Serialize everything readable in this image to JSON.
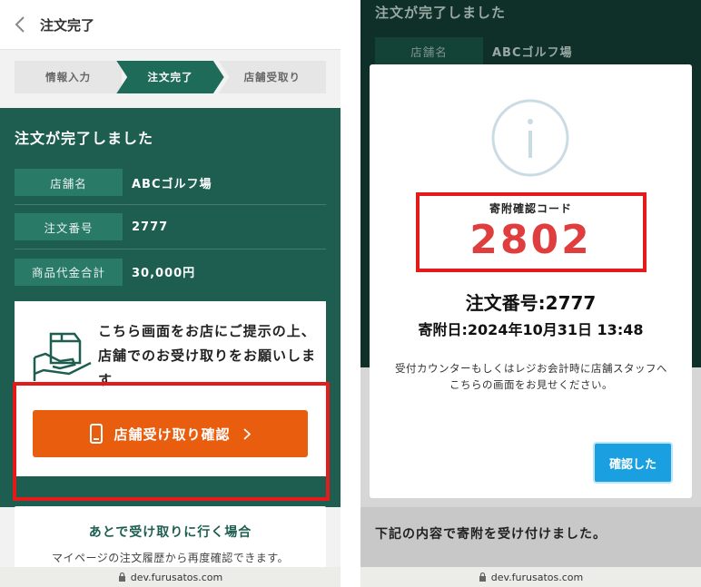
{
  "left": {
    "header": {
      "back_icon": "chevron-left-icon",
      "title": "注文完了"
    },
    "stepper": [
      "情報入力",
      "注文完了",
      "店舗受取り"
    ],
    "complete_title": "注文が完了しました",
    "info_rows": [
      {
        "label": "店舗名",
        "value": "ABCゴルフ場"
      },
      {
        "label": "注文番号",
        "value": "2777"
      },
      {
        "label": "商品代金合計",
        "value": "30,000円"
      }
    ],
    "instruction": "こちら画面をお店にご提示の上、店舗でのお受け取りをお願いします",
    "confirm_button": {
      "label": "店舗受け取り確認",
      "icon": "smartphone-icon"
    },
    "later": {
      "title": "あとで受け取りに行く場合",
      "text": "マイページの注文履歴から再度確認できます。"
    },
    "url": "dev.furusatos.com"
  },
  "right": {
    "bg_title": "注文が完了しました",
    "bg_row": {
      "label": "店舗名",
      "value": "ABCゴルフ場"
    },
    "modal": {
      "icon": "info-icon",
      "code_label": "寄附確認コード",
      "code_value": "2802",
      "order_number": "注文番号:2777",
      "donation_date": "寄附日:2024年10月31日 13:48",
      "notice": "受付カウンターもしくはレジお会計時に店舗スタッフへこちらの画面をお見せください。",
      "done_button": "確認した"
    },
    "below_text": "下記の内容で寄附を受け付けました。",
    "url": "dev.furusatos.com"
  },
  "colors": {
    "brand_green": "#1d5e51",
    "button_orange": "#e85d0e",
    "code_red": "#e03e3e",
    "highlight_red": "#e51a1a",
    "button_blue": "#1aa0e0"
  }
}
